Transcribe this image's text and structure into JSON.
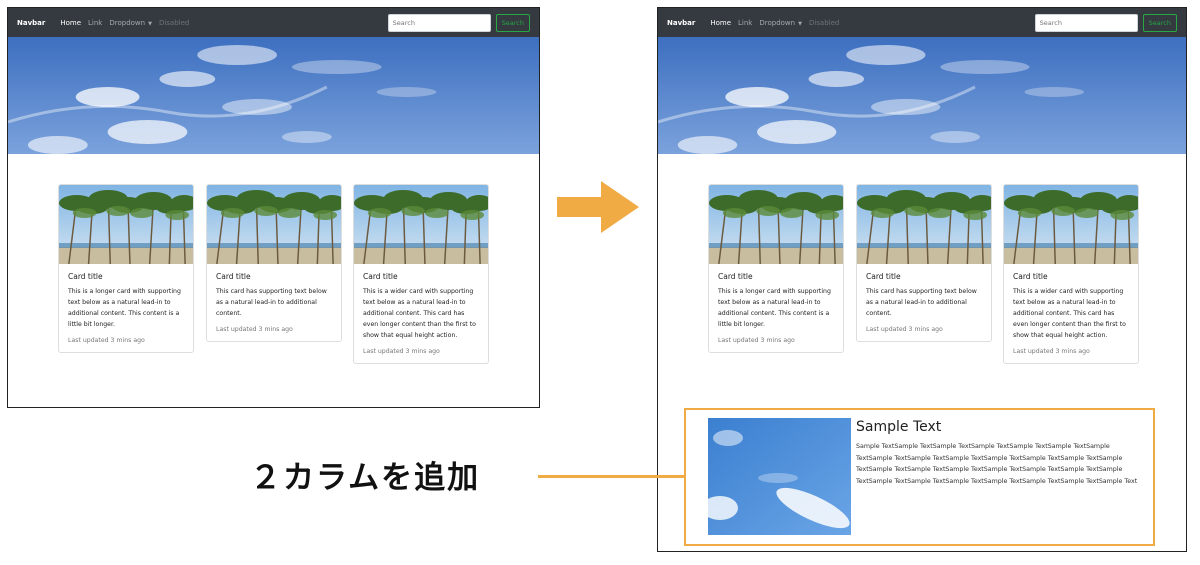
{
  "navbar": {
    "brand": "Navbar",
    "links": [
      "Home",
      "Link",
      "Dropdown",
      "Disabled"
    ],
    "search_placeholder": "Search",
    "search_button": "Search"
  },
  "cards": [
    {
      "title": "Card title",
      "text": "This is a longer card with supporting text below as a natural lead-in to additional content. This content is a little bit longer.",
      "updated": "Last updated 3 mins ago"
    },
    {
      "title": "Card title",
      "text": "This card has supporting text below as a natural lead-in to additional content.",
      "updated": "Last updated 3 mins ago"
    },
    {
      "title": "Card title",
      "text": "This is a wider card with supporting text below as a natural lead-in to additional content. This card has even longer content than the first to show that equal height action.",
      "updated": "Last updated 3 mins ago"
    }
  ],
  "callout": "２カラムを追加",
  "two_column": {
    "heading": "Sample Text",
    "text": "Sample TextSample TextSample TextSample TextSample TextSample TextSample TextSample TextSample TextSample TextSample TextSample TextSample TextSample TextSample TextSample TextSample TextSample TextSample TextSample TextSample TextSample TextSample TextSample TextSample TextSample TextSample TextSample Text"
  },
  "colors": {
    "accent": "#f0ab45",
    "navbar": "#343a40",
    "success": "#28a745"
  },
  "icons": [
    "arrow-right-icon",
    "caret-down-icon"
  ]
}
